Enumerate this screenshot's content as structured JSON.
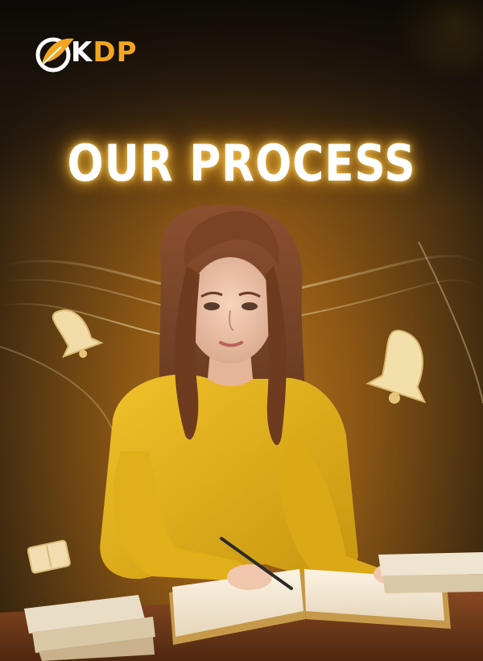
{
  "brand": {
    "logo_prefix": "K",
    "logo_accent_letters": "DP",
    "logo_full": "KDP"
  },
  "hero": {
    "title": "OUR PROCESS"
  },
  "colors": {
    "accent": "#f2a51f",
    "sweater": "#e3b21a",
    "hair": "#7a4323",
    "background_warm": "#8a5514",
    "glow": "#ffd24a"
  },
  "decor": {
    "floating_icons": [
      "bell-icon",
      "bell-icon",
      "book-icon"
    ]
  }
}
